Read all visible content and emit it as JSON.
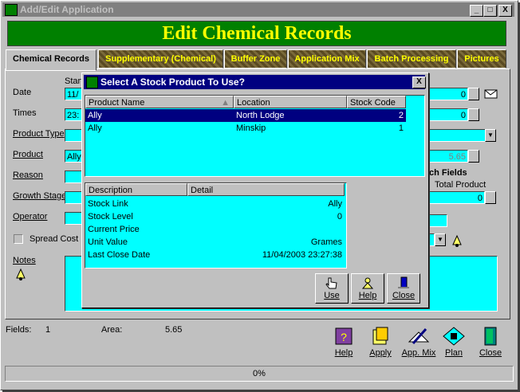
{
  "window": {
    "title": "Add/Edit Application",
    "controls": [
      "_",
      "□",
      "X"
    ]
  },
  "banner": "Edit Chemical Records",
  "tabs": [
    "Chemical Records",
    "Supplementary (Chemical)",
    "Buffer Zone",
    "Application Mix",
    "Batch Processing",
    "Pictures"
  ],
  "form": {
    "date_label": "Date",
    "times_label": "Times",
    "start_label": "Start",
    "date_value": "11/",
    "times_value": "23:",
    "product_type_label": "Product Type",
    "product_label": "Product",
    "product_value": "Ally",
    "reason_label": "Reason",
    "growth_stage_label": "Growth Stage",
    "operator_label": "Operator",
    "spread_cost_label": "Spread Cost",
    "notes_label": "Notes",
    "right_field1": "0",
    "right_field2": "0",
    "right_field3": "5.65",
    "batch_fields_label": "ch Fields",
    "total_product_label": "Total Product",
    "total_product_value": "0"
  },
  "dialog": {
    "title": "Select A Stock Product To Use?",
    "columns": [
      "Product Name",
      "Location",
      "Stock Code"
    ],
    "rows": [
      {
        "product": "Ally",
        "location": "North Lodge",
        "code": "2",
        "selected": true
      },
      {
        "product": "Ally",
        "location": "Minskip",
        "code": "1",
        "selected": false
      }
    ],
    "detail_columns": [
      "Description",
      "Detail"
    ],
    "details": [
      {
        "desc": "Stock Link",
        "value": "Ally"
      },
      {
        "desc": "Stock Level",
        "value": "0"
      },
      {
        "desc": "Current Price",
        "value": ""
      },
      {
        "desc": "Unit Value",
        "value": "Grames"
      },
      {
        "desc": "Last Close Date",
        "value": "11/04/2003 23:27:38"
      }
    ],
    "buttons": [
      "Use",
      "Help",
      "Close"
    ]
  },
  "footer": {
    "fields_label": "Fields:",
    "fields_value": "1",
    "area_label": "Area:",
    "area_value": "5.65",
    "buttons": [
      "Help",
      "Apply",
      "App. Mix",
      "Plan",
      "Close"
    ],
    "progress": "0%"
  },
  "colors": {
    "field": "#00ffff",
    "banner_bg": "#008000",
    "banner_text": "#ffff00",
    "selection": "#000080",
    "face": "#c0c0c0"
  }
}
